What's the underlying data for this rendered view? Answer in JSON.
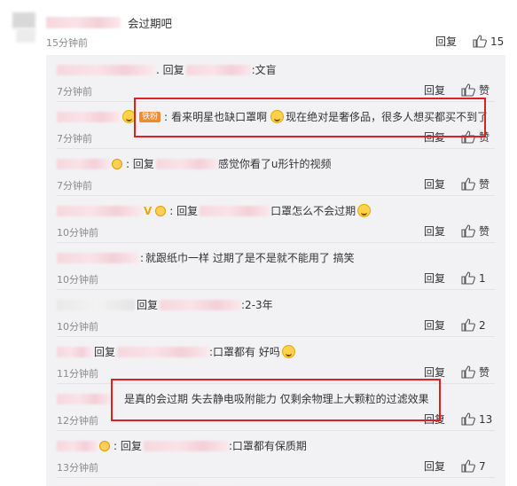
{
  "top_comment": {
    "text": "会过期吧",
    "time": "15分钟前",
    "reply_label": "回复",
    "like_count": "15"
  },
  "replies": [
    {
      "prefix": ". 回复",
      "text": ":文盲",
      "time": "7分钟前",
      "reply_label": "回复",
      "like": "赞"
    },
    {
      "badge": "铁粉",
      "text": "看来明星也缺口罩啊",
      "text2": "现在绝对是奢侈品，很多人想买都买不到了",
      "time": "7分钟前",
      "reply_label": "回复",
      "like": "赞"
    },
    {
      "prefix": ": 回复",
      "text": "感觉你看了u形针的视频",
      "time": "7分钟前",
      "reply_label": "回复",
      "like": "赞"
    },
    {
      "prefix": ": 回复",
      "text": "口罩怎么不会过期",
      "time": "10分钟前",
      "reply_label": "回复",
      "like": "赞"
    },
    {
      "prefix": ":",
      "text": "就跟纸巾一样 过期了是不是就不能用了 搞笑",
      "time": "10分钟前",
      "reply_label": "回复",
      "like": "1"
    },
    {
      "prefix": "回复",
      "text": ":2-3年",
      "time": "10分钟前",
      "reply_label": "回复",
      "like": "2"
    },
    {
      "prefix": "回复",
      "text": ":口罩都有 好吗",
      "time": "11分钟前",
      "reply_label": "回复",
      "like": "赞"
    },
    {
      "text": "是真的会过期 失去静电吸附能力 仅剩余物理上大颗粒的过滤效果",
      "time": "12分钟前",
      "reply_label": "回复",
      "like": "13"
    },
    {
      "prefix": ": 回复",
      "text": ":口罩都有保质期",
      "time": "13分钟前",
      "reply_label": "回复",
      "like": "7"
    }
  ],
  "colors": {
    "highlight": "#e02020",
    "reply_bg": "#f2f2f5",
    "time": "#8a8a8a"
  }
}
